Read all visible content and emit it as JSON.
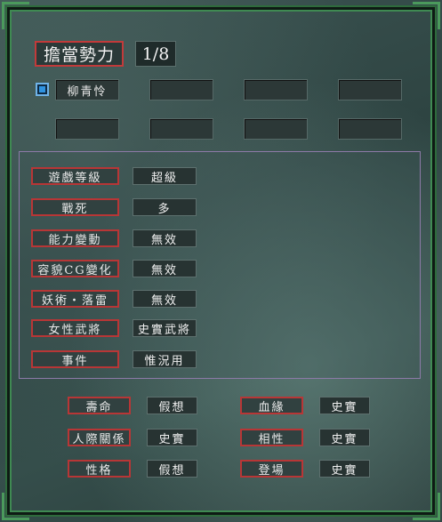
{
  "header": {
    "title": "擔當勢力",
    "count": "1/8"
  },
  "slots": [
    {
      "label": "柳青怜",
      "checked": true
    },
    {
      "label": ""
    },
    {
      "label": ""
    },
    {
      "label": ""
    },
    {
      "label": ""
    },
    {
      "label": ""
    },
    {
      "label": ""
    },
    {
      "label": ""
    }
  ],
  "options": [
    {
      "label": "遊戲等級",
      "value": "超級"
    },
    {
      "label": "戰死",
      "value": "多"
    },
    {
      "label": "能力變動",
      "value": "無效"
    },
    {
      "label": "容貌CG變化",
      "value": "無效"
    },
    {
      "label": "妖術・落雷",
      "value": "無效"
    },
    {
      "label": "女性武將",
      "value": "史實武將"
    },
    {
      "label": "事件",
      "value": "惟況用"
    }
  ],
  "settings": [
    {
      "label": "壽命",
      "value": "假想"
    },
    {
      "label": "血緣",
      "value": "史實"
    },
    {
      "label": "人際關係",
      "value": "史實"
    },
    {
      "label": "相性",
      "value": "史實"
    },
    {
      "label": "性格",
      "value": "假想"
    },
    {
      "label": "登場",
      "value": "史實"
    }
  ],
  "colors": {
    "accent_red": "#c23a3a",
    "frame_green": "#3f8a52",
    "checkbox_blue": "#2f93e0"
  }
}
